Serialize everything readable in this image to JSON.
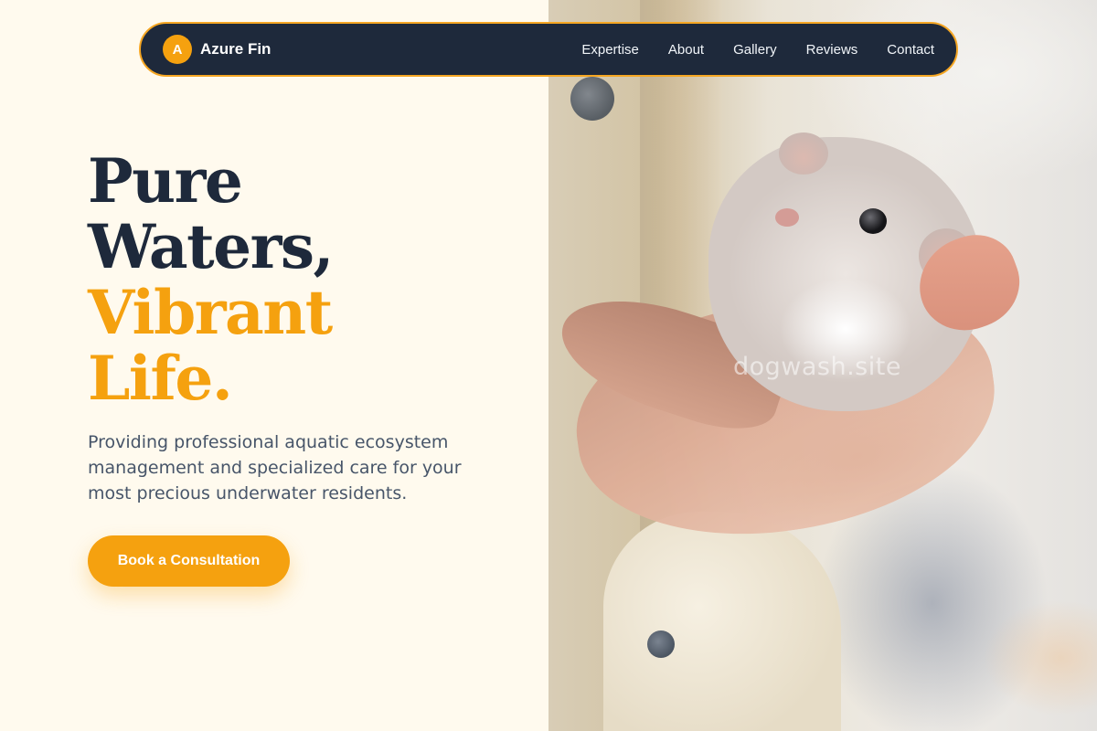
{
  "nav": {
    "logo_letter": "A",
    "brand_name": "Azure Fin",
    "links": [
      "Expertise",
      "About",
      "Gallery",
      "Reviews",
      "Contact"
    ]
  },
  "hero": {
    "title_dark": [
      "Pure",
      "Waters,"
    ],
    "title_accent": [
      "Vibrant",
      "Life."
    ],
    "description": "Providing professional aquatic ecosystem management and specialized care for your most precious underwater residents.",
    "cta_label": "Book a Consultation"
  },
  "image": {
    "watermark": "dogwash.site"
  },
  "colors": {
    "navy": "#1e293b",
    "accent": "#f5a10f",
    "background": "#fffaee",
    "body_text": "#475569"
  }
}
